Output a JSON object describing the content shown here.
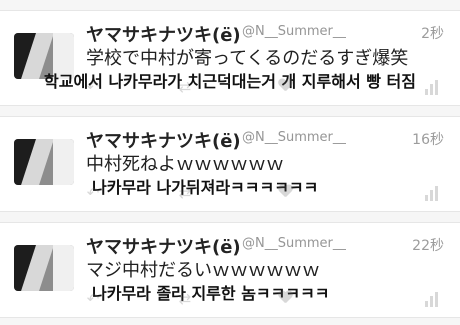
{
  "tweets": [
    {
      "user_name": "ヤマサキナツキ(ë)",
      "user_handle": "@N__Summer__",
      "time": "2秒",
      "text_jp": "学校で中村が寄ってくるのだるすぎ爆笑",
      "caption_ko": "학교에서 나카무라가 치근덕대는거 개 지루해서 빵 터짐"
    },
    {
      "user_name": "ヤマサキナツキ(ë)",
      "user_handle": "@N__Summer__",
      "time": "16秒",
      "text_jp": "中村死ねよｗｗｗｗｗｗ",
      "caption_ko": "나카무라 나가뒤져라ㅋㅋㅋㅋㅋㅋ"
    },
    {
      "user_name": "ヤマサキナツキ(ë)",
      "user_handle": "@N__Summer__",
      "time": "22秒",
      "text_jp": "マジ中村だるいｗｗｗｗｗｗ",
      "caption_ko": "나카무라 졸라 지루한 놈ㅋㅋㅋㅋㅋ"
    }
  ],
  "icons": {
    "reply": "reply-icon",
    "retweet": "retweet-icon",
    "favorite": "heart-icon",
    "stats": "stats-icon"
  }
}
